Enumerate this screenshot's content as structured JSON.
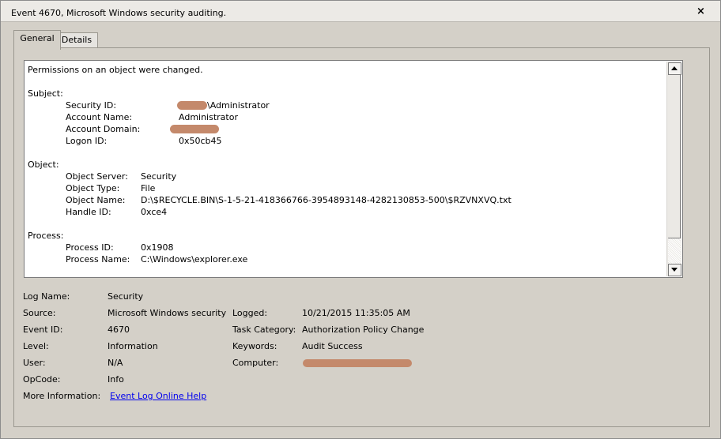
{
  "window": {
    "title": "Event 4670, Microsoft Windows security auditing.",
    "close_symbol": "×"
  },
  "tabs": [
    {
      "label": "General"
    },
    {
      "label": "Details"
    }
  ],
  "message": {
    "summary": "Permissions on an object were changed.",
    "subject": {
      "heading": "Subject:",
      "security_id_label": "Security ID:",
      "security_id_value": "\\Administrator",
      "account_name_label": "Account Name:",
      "account_name_value": "Administrator",
      "account_domain_label": "Account Domain:",
      "logon_id_label": "Logon ID:",
      "logon_id_value": "0x50cb45"
    },
    "object": {
      "heading": "Object:",
      "server_label": "Object Server:",
      "server_value": "Security",
      "type_label": "Object Type:",
      "type_value": "File",
      "name_label": "Object Name:",
      "name_value": "D:\\$RECYCLE.BIN\\S-1-5-21-418366766-3954893148-4282130853-500\\$RZVNXVQ.txt",
      "handle_label": "Handle ID:",
      "handle_value": "0xce4"
    },
    "process": {
      "heading": "Process:",
      "id_label": "Process ID:",
      "id_value": "0x1908",
      "name_label": "Process Name:",
      "name_value": "C:\\Windows\\explorer.exe"
    }
  },
  "properties": {
    "log_name_label": "Log Name:",
    "log_name_value": "Security",
    "source_label": "Source:",
    "source_value": "Microsoft Windows security",
    "logged_label": "Logged:",
    "logged_value": "10/21/2015 11:35:05 AM",
    "event_id_label": "Event ID:",
    "event_id_value": "4670",
    "task_category_label": "Task Category:",
    "task_category_value": "Authorization Policy Change",
    "level_label": "Level:",
    "level_value": "Information",
    "keywords_label": "Keywords:",
    "keywords_value": "Audit Success",
    "user_label": "User:",
    "user_value": "N/A",
    "computer_label": "Computer:",
    "opcode_label": "OpCode:",
    "opcode_value": "Info",
    "more_info_label": "More Information:",
    "more_info_link": "Event Log Online Help"
  },
  "colors": {
    "redaction": "#c4896b",
    "link": "#0000ee",
    "background": "#d4d0c8"
  }
}
